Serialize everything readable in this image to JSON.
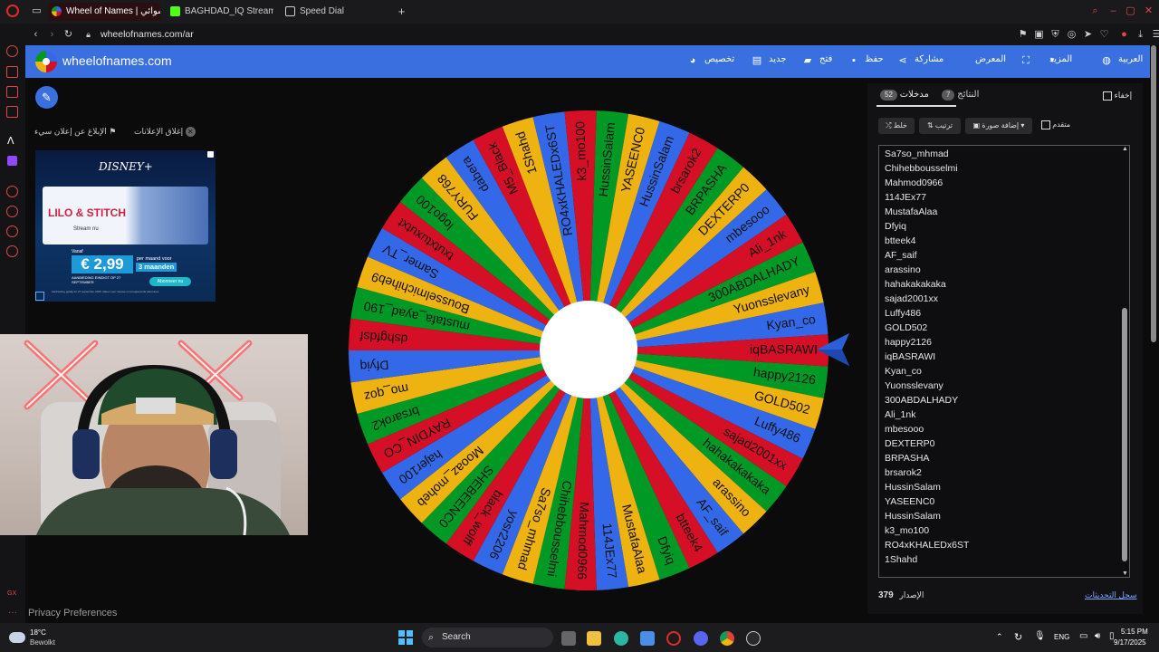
{
  "browser": {
    "tabs": [
      {
        "title": "Wheel of Names | عشوائي",
        "active": true
      },
      {
        "title": "BAGHDAD_IQ Stream - W",
        "active": false
      },
      {
        "title": "Speed Dial",
        "active": false
      }
    ],
    "new_tab_symbol": "+",
    "url": "wheelofnames.com/ar"
  },
  "header": {
    "site_name": "wheelofnames.com",
    "menu": [
      "تخصيص",
      "جديد",
      "فتح",
      "حفظ",
      "مشاركة",
      "المعرض",
      "المزيد",
      "العربية"
    ]
  },
  "ads": {
    "report_label": "الإبلاغ عن إعلان سيء",
    "close_label": "إغلاق الإعلانات",
    "brand": "DISNEY+",
    "title": "LILO & STITCH",
    "subtitle": "Stream nu",
    "from_label": "Vanaf",
    "price": "€ 2,99",
    "per_month": "per maand voor",
    "months": "3 maanden",
    "promo": "AANBIEDING EINDIGT OP 27 SEPTEMBER",
    "cta": "Abonneer nu",
    "fine_print": "Aanbieding geldig tot 27 september 2025. Alleen voor nieuwe en terugkerende abonnees."
  },
  "wheel": {
    "entries": [
      "1Shahd",
      "RO4xKHALEDx6ST",
      "k3_mo100",
      "HussinSalam",
      "YASEENC0",
      "HussinSalam",
      "brsarok2",
      "BRPASHA",
      "DEXTERP0",
      "mbesooo",
      "Ali_1nk",
      "300ABDALHADY",
      "Yuonsslevany",
      "Kyan_co",
      "iqBASRAWI",
      "happy2126",
      "GOLD502",
      "Luffy486",
      "sajad2001xx",
      "hahakakakaka",
      "arassino",
      "AF_saif",
      "btteek4",
      "Dfyiq",
      "MustafaAlaa",
      "114JEx77",
      "Mahmod0966",
      "Chihebbousselmi",
      "Sa7so_mhmad",
      "yosr2206",
      "black_wolff",
      "SHEBEENC0",
      "Mooaz_moheb",
      "hajer100",
      "RAYDIN_CO",
      "brsarok2",
      "mo_qoz",
      "Dfyiq",
      "dshgfdsf",
      "mustafa_ayad_190",
      "Bousselmichiheb9",
      "Samer_TV",
      "txutxtuxutxt",
      "logo100",
      "FURY768",
      "dabera",
      "M5_Black"
    ],
    "colors": [
      "#eeb211",
      "#3369e8",
      "#d50f25",
      "#009925"
    ]
  },
  "panel": {
    "tab_entries": "مدخلات",
    "tab_entries_count": "52",
    "tab_results": "النتائج",
    "tab_results_count": "7",
    "hide_label": "إخفاء",
    "shuffle_label": "خلط",
    "sort_label": "ترتيب",
    "add_image_label": "إضافة صورة",
    "advanced_label": "متقدم",
    "list": [
      "Sa7so_mhmad",
      "Chihebbousselmi",
      "Mahmod0966",
      "114JEx77",
      "MustafaAlaa",
      "Dfyiq",
      "btteek4",
      "AF_saif",
      "arassino",
      "hahakakakaka",
      "sajad2001xx",
      "Luffy486",
      "GOLD502",
      "happy2126",
      "iqBASRAWI",
      "Kyan_co",
      "Yuonsslevany",
      "300ABDALHADY",
      "Ali_1nk",
      "mbesooo",
      "DEXTERP0",
      "BRPASHA",
      "brsarok2",
      "HussinSalam",
      "YASEENC0",
      "HussinSalam",
      "k3_mo100",
      "RO4xKHALEDx6ST",
      "1Shahd"
    ],
    "version_label": "الإصدار",
    "version": "379",
    "changelog_label": "سجل التحديثات"
  },
  "footer": {
    "privacy": "Privacy Preferences"
  },
  "taskbar": {
    "weather_temp": "18°C",
    "weather_desc": "Bewolkt",
    "search": "Search",
    "lang": "ENG",
    "time": "5:15 PM",
    "date": "9/17/2025"
  }
}
